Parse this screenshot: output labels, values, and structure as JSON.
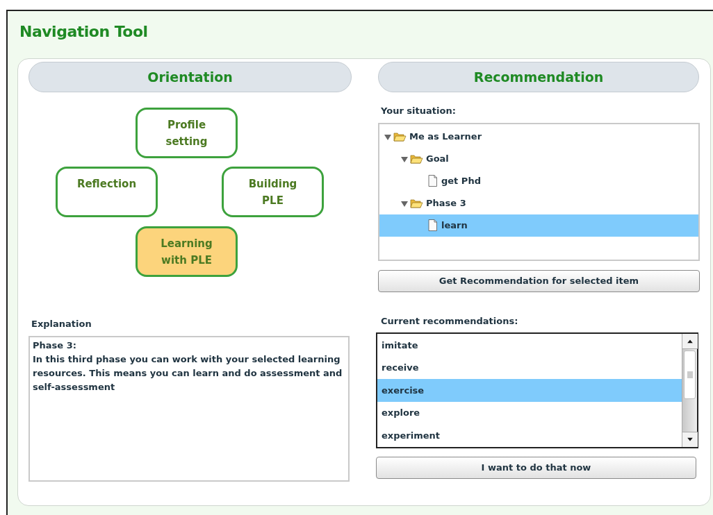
{
  "title": "Navigation Tool",
  "orientation": {
    "heading": "Orientation",
    "phases": [
      {
        "label": "Profile\nsetting",
        "selected": false
      },
      {
        "label": "Reflection",
        "selected": false
      },
      {
        "label": "Building\nPLE",
        "selected": false
      },
      {
        "label": "Learning\nwith PLE",
        "selected": true
      }
    ],
    "explanation": {
      "label": "Explanation",
      "text": "Phase 3:\nIn this third phase you can work with your selected learning resources. This means you can learn and do assessment and self-assessment"
    }
  },
  "recommendation": {
    "heading": "Recommendation",
    "situation_label": "Your situation:",
    "tree": [
      {
        "label": "Me as Learner",
        "kind": "folder",
        "expanded": true,
        "selected": false,
        "children": [
          {
            "label": "Goal",
            "kind": "folder",
            "expanded": true,
            "selected": false,
            "children": [
              {
                "label": "get Phd",
                "kind": "file",
                "selected": false
              }
            ]
          },
          {
            "label": "Phase 3",
            "kind": "folder",
            "expanded": true,
            "selected": false,
            "children": [
              {
                "label": "learn",
                "kind": "file",
                "selected": true
              }
            ]
          }
        ]
      }
    ],
    "get_button": "Get Recommendation for selected item",
    "current_label": "Current recommendations:",
    "recommendations": [
      {
        "label": "imitate",
        "selected": false
      },
      {
        "label": "receive",
        "selected": false
      },
      {
        "label": "exercise",
        "selected": true
      },
      {
        "label": "explore",
        "selected": false
      },
      {
        "label": "experiment",
        "selected": false
      }
    ],
    "do_button": "I want to do that now"
  }
}
